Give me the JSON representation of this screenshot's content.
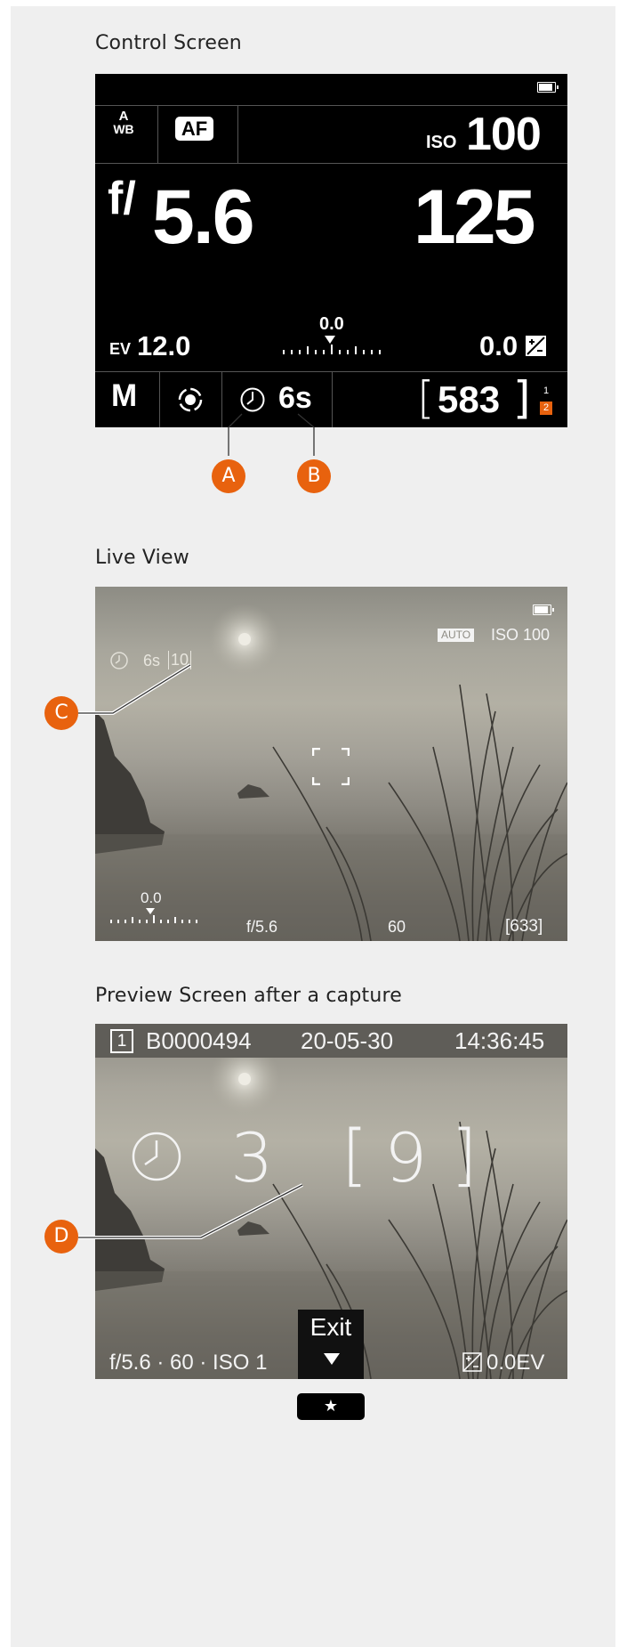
{
  "sections": {
    "control_title": "Control Screen",
    "live_title": "Live View",
    "preview_title": "Preview Screen after a capture"
  },
  "control_screen": {
    "wb_top": "A",
    "wb_bottom": "WB",
    "af_label": "AF",
    "iso_label": "ISO",
    "iso_value": "100",
    "aperture_prefix": "f/",
    "aperture_value": "5.6",
    "shutter_value": "125",
    "ev_label": "EV",
    "ev_value": "12.0",
    "scale_value": "0.0",
    "exp_comp_value": "0.0",
    "exp_comp_icon": "exposure-compensation-icon",
    "mode": "M",
    "metering_icon": "spot-metering-icon",
    "timer_icon": "self-timer-icon",
    "timer_value": "6s",
    "shots_remaining": "583",
    "card_slot_1": "1",
    "card_slot_2": "2"
  },
  "markers": {
    "a": "A",
    "b": "B",
    "c": "C",
    "d": "D"
  },
  "live_view": {
    "auto_badge": "AUTO",
    "iso_text": "ISO 100",
    "timer_value": "6s",
    "timer_count": "10",
    "scale_value": "0.0",
    "aperture": "f/5.6",
    "shutter": "60",
    "shots": "[633]"
  },
  "preview_screen": {
    "slot": "1",
    "file_name": "B0000494",
    "date": "20-05-30",
    "time": "14:36:45",
    "countdown": "3",
    "count_open": "[",
    "count_value": "9",
    "count_close": "]",
    "exit_label": "Exit",
    "bottom_info": "f/5.6 · 60 ·  ISO 1",
    "ev_text": "0.0EV",
    "star_button": "★"
  },
  "colors": {
    "accent": "#e8620e",
    "background": "#efefef",
    "screen": "#000000"
  }
}
